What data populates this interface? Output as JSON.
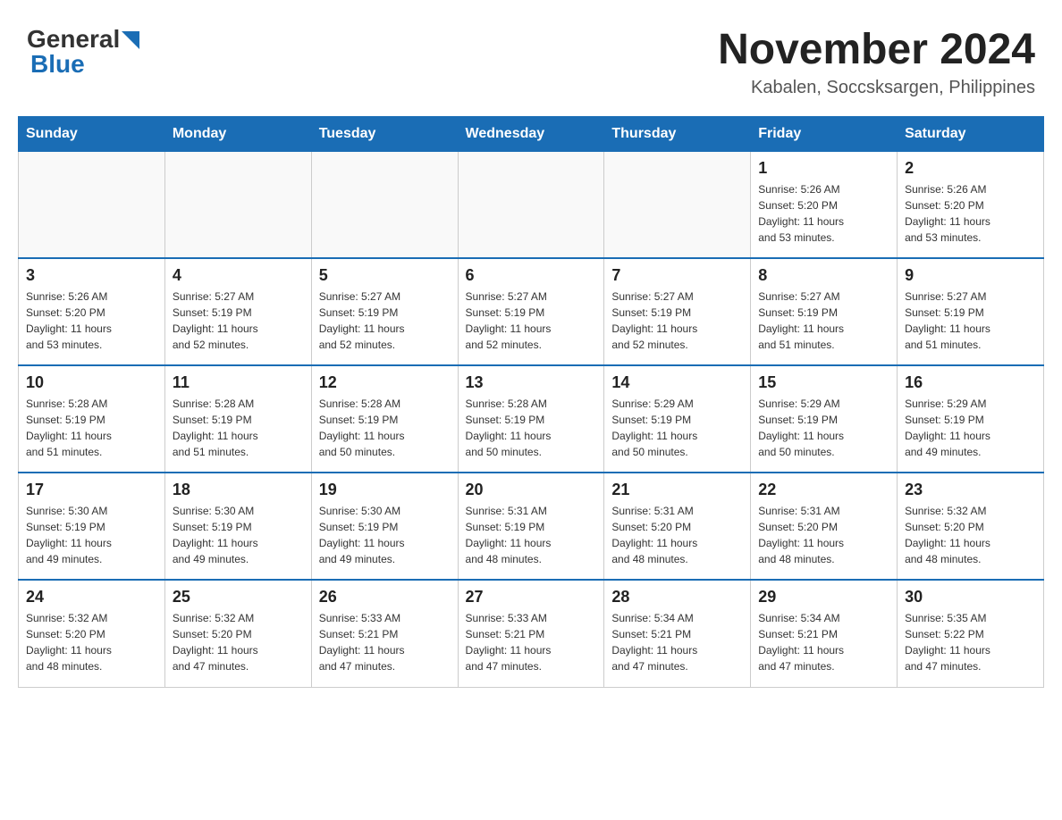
{
  "logo": {
    "general_text": "General",
    "blue_text": "Blue"
  },
  "title": "November 2024",
  "location": "Kabalen, Soccsksargen, Philippines",
  "weekdays": [
    "Sunday",
    "Monday",
    "Tuesday",
    "Wednesday",
    "Thursday",
    "Friday",
    "Saturday"
  ],
  "weeks": [
    [
      {
        "day": "",
        "info": ""
      },
      {
        "day": "",
        "info": ""
      },
      {
        "day": "",
        "info": ""
      },
      {
        "day": "",
        "info": ""
      },
      {
        "day": "",
        "info": ""
      },
      {
        "day": "1",
        "info": "Sunrise: 5:26 AM\nSunset: 5:20 PM\nDaylight: 11 hours\nand 53 minutes."
      },
      {
        "day": "2",
        "info": "Sunrise: 5:26 AM\nSunset: 5:20 PM\nDaylight: 11 hours\nand 53 minutes."
      }
    ],
    [
      {
        "day": "3",
        "info": "Sunrise: 5:26 AM\nSunset: 5:20 PM\nDaylight: 11 hours\nand 53 minutes."
      },
      {
        "day": "4",
        "info": "Sunrise: 5:27 AM\nSunset: 5:19 PM\nDaylight: 11 hours\nand 52 minutes."
      },
      {
        "day": "5",
        "info": "Sunrise: 5:27 AM\nSunset: 5:19 PM\nDaylight: 11 hours\nand 52 minutes."
      },
      {
        "day": "6",
        "info": "Sunrise: 5:27 AM\nSunset: 5:19 PM\nDaylight: 11 hours\nand 52 minutes."
      },
      {
        "day": "7",
        "info": "Sunrise: 5:27 AM\nSunset: 5:19 PM\nDaylight: 11 hours\nand 52 minutes."
      },
      {
        "day": "8",
        "info": "Sunrise: 5:27 AM\nSunset: 5:19 PM\nDaylight: 11 hours\nand 51 minutes."
      },
      {
        "day": "9",
        "info": "Sunrise: 5:27 AM\nSunset: 5:19 PM\nDaylight: 11 hours\nand 51 minutes."
      }
    ],
    [
      {
        "day": "10",
        "info": "Sunrise: 5:28 AM\nSunset: 5:19 PM\nDaylight: 11 hours\nand 51 minutes."
      },
      {
        "day": "11",
        "info": "Sunrise: 5:28 AM\nSunset: 5:19 PM\nDaylight: 11 hours\nand 51 minutes."
      },
      {
        "day": "12",
        "info": "Sunrise: 5:28 AM\nSunset: 5:19 PM\nDaylight: 11 hours\nand 50 minutes."
      },
      {
        "day": "13",
        "info": "Sunrise: 5:28 AM\nSunset: 5:19 PM\nDaylight: 11 hours\nand 50 minutes."
      },
      {
        "day": "14",
        "info": "Sunrise: 5:29 AM\nSunset: 5:19 PM\nDaylight: 11 hours\nand 50 minutes."
      },
      {
        "day": "15",
        "info": "Sunrise: 5:29 AM\nSunset: 5:19 PM\nDaylight: 11 hours\nand 50 minutes."
      },
      {
        "day": "16",
        "info": "Sunrise: 5:29 AM\nSunset: 5:19 PM\nDaylight: 11 hours\nand 49 minutes."
      }
    ],
    [
      {
        "day": "17",
        "info": "Sunrise: 5:30 AM\nSunset: 5:19 PM\nDaylight: 11 hours\nand 49 minutes."
      },
      {
        "day": "18",
        "info": "Sunrise: 5:30 AM\nSunset: 5:19 PM\nDaylight: 11 hours\nand 49 minutes."
      },
      {
        "day": "19",
        "info": "Sunrise: 5:30 AM\nSunset: 5:19 PM\nDaylight: 11 hours\nand 49 minutes."
      },
      {
        "day": "20",
        "info": "Sunrise: 5:31 AM\nSunset: 5:19 PM\nDaylight: 11 hours\nand 48 minutes."
      },
      {
        "day": "21",
        "info": "Sunrise: 5:31 AM\nSunset: 5:20 PM\nDaylight: 11 hours\nand 48 minutes."
      },
      {
        "day": "22",
        "info": "Sunrise: 5:31 AM\nSunset: 5:20 PM\nDaylight: 11 hours\nand 48 minutes."
      },
      {
        "day": "23",
        "info": "Sunrise: 5:32 AM\nSunset: 5:20 PM\nDaylight: 11 hours\nand 48 minutes."
      }
    ],
    [
      {
        "day": "24",
        "info": "Sunrise: 5:32 AM\nSunset: 5:20 PM\nDaylight: 11 hours\nand 48 minutes."
      },
      {
        "day": "25",
        "info": "Sunrise: 5:32 AM\nSunset: 5:20 PM\nDaylight: 11 hours\nand 47 minutes."
      },
      {
        "day": "26",
        "info": "Sunrise: 5:33 AM\nSunset: 5:21 PM\nDaylight: 11 hours\nand 47 minutes."
      },
      {
        "day": "27",
        "info": "Sunrise: 5:33 AM\nSunset: 5:21 PM\nDaylight: 11 hours\nand 47 minutes."
      },
      {
        "day": "28",
        "info": "Sunrise: 5:34 AM\nSunset: 5:21 PM\nDaylight: 11 hours\nand 47 minutes."
      },
      {
        "day": "29",
        "info": "Sunrise: 5:34 AM\nSunset: 5:21 PM\nDaylight: 11 hours\nand 47 minutes."
      },
      {
        "day": "30",
        "info": "Sunrise: 5:35 AM\nSunset: 5:22 PM\nDaylight: 11 hours\nand 47 minutes."
      }
    ]
  ]
}
